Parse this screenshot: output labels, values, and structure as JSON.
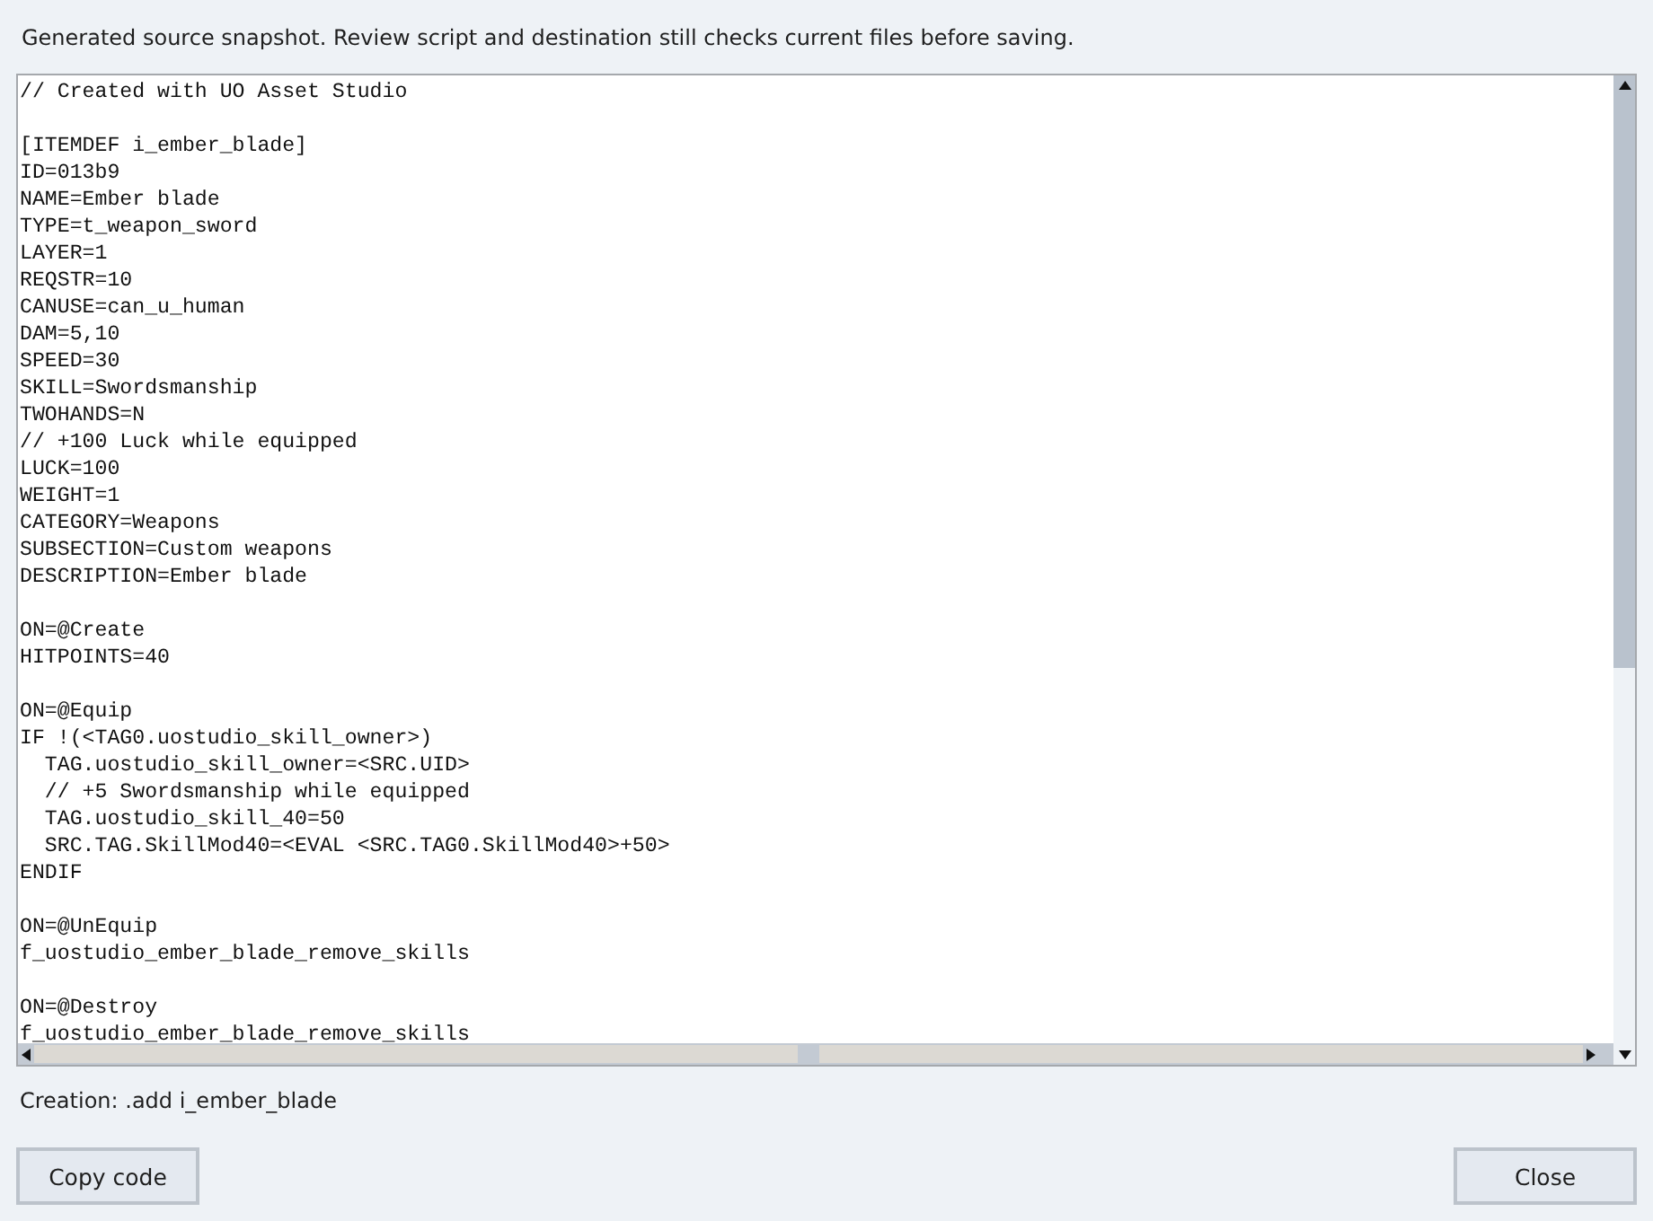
{
  "notice": "Generated source snapshot. Review script and destination still checks current files before saving.",
  "code_blocks": [
    [
      "// Created with UO Asset Studio"
    ],
    [
      "[ITEMDEF i_ember_blade]",
      "ID=013b9",
      "NAME=Ember blade",
      "TYPE=t_weapon_sword",
      "LAYER=1",
      "REQSTR=10",
      "CANUSE=can_u_human",
      "DAM=5,10",
      "SPEED=30",
      "SKILL=Swordsmanship",
      "TWOHANDS=N",
      "// +100 Luck while equipped",
      "LUCK=100",
      "WEIGHT=1",
      "CATEGORY=Weapons",
      "SUBSECTION=Custom weapons",
      "DESCRIPTION=Ember blade"
    ],
    [
      "ON=@Create",
      "HITPOINTS=40"
    ],
    [
      "ON=@Equip",
      "IF !(<TAG0.uostudio_skill_owner>)",
      "  TAG.uostudio_skill_owner=<SRC.UID>",
      "  // +5 Swordsmanship while equipped",
      "  TAG.uostudio_skill_40=50",
      "  SRC.TAG.SkillMod40=<EVAL <SRC.TAG0.SkillMod40>+50>",
      "ENDIF"
    ],
    [
      "ON=@UnEquip",
      "f_uostudio_ember_blade_remove_skills"
    ],
    [
      "ON=@Destroy",
      "f_uostudio_ember_blade_remove_skills"
    ]
  ],
  "creation": "Creation: .add i_ember_blade",
  "buttons": [
    {
      "label": "Copy code",
      "kind": "left"
    },
    {
      "label": "Close",
      "kind": "right"
    }
  ]
}
